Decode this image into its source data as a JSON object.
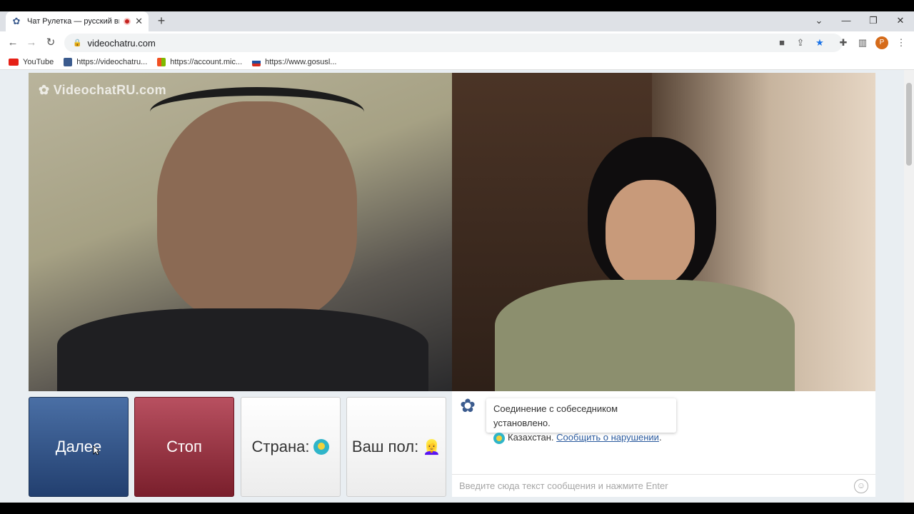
{
  "browser": {
    "tab_title": "Чат Рулетка — русский вид",
    "tab_close": "✕",
    "new_tab": "+",
    "window_controls": [
      "⌄",
      "—",
      "❐",
      "✕"
    ],
    "url": "videochatru.com",
    "bookmarks": [
      {
        "label": "YouTube",
        "color": "#e62117"
      },
      {
        "label": "https://videochatru...",
        "color": "#3b5b8e"
      },
      {
        "label": "https://account.mic...",
        "color": "#7fba00"
      },
      {
        "label": "https://www.gosusl...",
        "color": "#1e4fa0"
      }
    ],
    "profile_initial": "P"
  },
  "video": {
    "logo_text": "VideochatRU.com"
  },
  "controls": {
    "next_label": "Далее",
    "stop_label": "Стоп",
    "country_label": "Страна:",
    "gender_label": "Ваш пол:",
    "gender_emoji": "👱‍♀️"
  },
  "chat": {
    "system_message": "Соединение с собеседником установлено.",
    "country_name": "Казахстан.",
    "report_link": "Сообщить о нарушении",
    "report_suffix": ".",
    "input_placeholder": "Введите сюда текст сообщения и нажмите Enter"
  },
  "colors": {
    "next_button": "#34598f",
    "stop_button": "#9a3343",
    "page_bg": "#e9eef2",
    "link": "#2a5a9e"
  }
}
